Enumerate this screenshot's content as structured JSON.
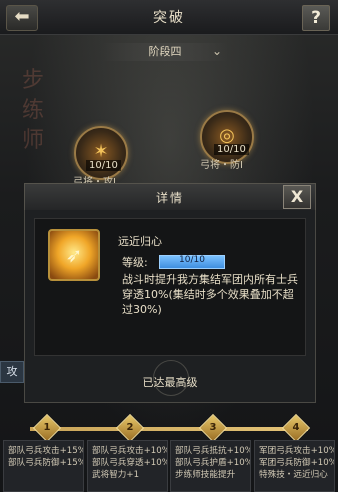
{
  "header": {
    "title": "突破",
    "back_icon": "back-arrow-icon",
    "help_label": "?"
  },
  "stage": {
    "label": "阶段四"
  },
  "watermark": "步练师",
  "nodes": [
    {
      "count": "10/10",
      "label": "弓将・攻Ⅰ",
      "icon": "bow-attack-icon"
    },
    {
      "count": "10/10",
      "label": "弓将・防Ⅰ",
      "icon": "bow-defense-icon"
    }
  ],
  "dialog": {
    "title": "详情",
    "close_label": "X",
    "skill": {
      "name": "远近归心",
      "level_label": "等级:",
      "level_value": "10/10",
      "level_progress": 1.0,
      "description": "战斗时提升我方集结军团内所有士兵穿透10%(集结时多个效果叠加不超过30%)"
    },
    "status": "已达最高级"
  },
  "side_tab": {
    "label": "攻"
  },
  "track": {
    "markers": [
      "1",
      "2",
      "3",
      "4"
    ]
  },
  "bonuses": [
    [
      "部队弓兵攻击+15%",
      "部队弓兵防御+15%"
    ],
    [
      "部队弓兵攻击+10%",
      "部队弓兵穿透+10%",
      "武将智力+1"
    ],
    [
      "部队弓兵抵抗+10%",
      "部队弓兵护盾+10%",
      "步练师技能提升"
    ],
    [
      "军团弓兵攻击+10%",
      "军团弓兵防御+10%",
      "特殊技・远近归心"
    ]
  ],
  "colors": {
    "accent_gold": "#e4c478",
    "level_bar": "#5aaaf0"
  }
}
